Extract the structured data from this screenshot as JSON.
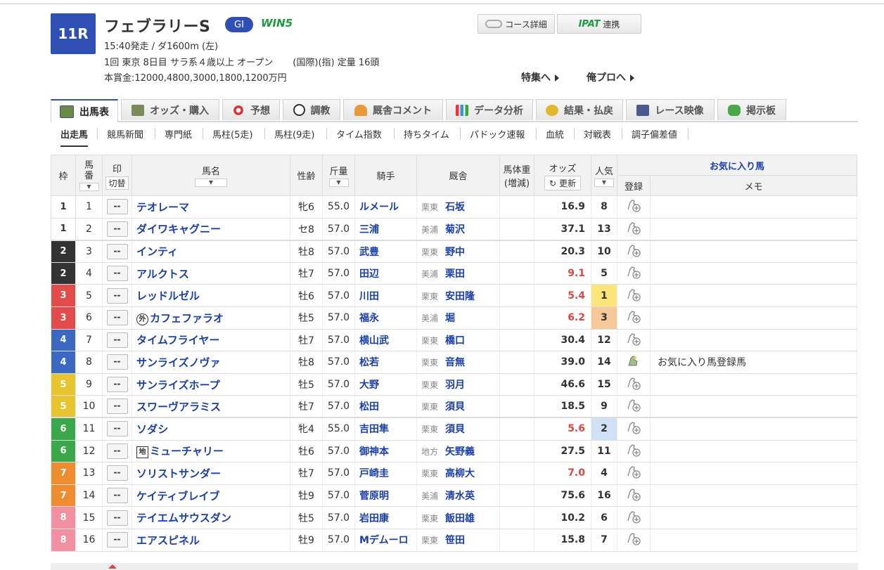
{
  "race": {
    "number": "11R",
    "name": "フェブラリーS",
    "grade": "GI",
    "win5": "WIN5",
    "start_info": "15:40発走 / ダ1600m (左)",
    "meeting_info": "1回 東京 8日目 サラ系４歳以上 オープン",
    "conditions": "(国際)(指) 定量 16頭",
    "prize": "本賞金:12000,4800,3000,1800,1200万円"
  },
  "top_buttons": {
    "course": "コース詳細",
    "ipat_logo": "IPAT",
    "ipat": "連携"
  },
  "links": {
    "feature": "特集へ",
    "orepro": "俺プロへ"
  },
  "tabs": [
    {
      "label": "出馬表",
      "icon": "table-icon"
    },
    {
      "label": "オッズ・購入",
      "icon": "odds-icon"
    },
    {
      "label": "予想",
      "icon": "target-icon"
    },
    {
      "label": "調教",
      "icon": "stopwatch-icon"
    },
    {
      "label": "厩舎コメント",
      "icon": "stable-icon"
    },
    {
      "label": "データ分析",
      "icon": "bar-chart-icon"
    },
    {
      "label": "結果・払戻",
      "icon": "coins-icon"
    },
    {
      "label": "レース映像",
      "icon": "video-icon"
    },
    {
      "label": "掲示板",
      "icon": "chat-icon"
    }
  ],
  "subnav": [
    "出走馬",
    "競馬新聞",
    "専門紙",
    "馬柱(5走)",
    "馬柱(9走)",
    "タイム指数",
    "持ちタイム",
    "パドック速報",
    "血統",
    "対戦表",
    "調子偏差値"
  ],
  "table_headers": {
    "waku": "枠",
    "umaban": "馬番",
    "mark": "印",
    "mark_switch": "切替",
    "horse": "馬名",
    "sex_age": "性齢",
    "weight_carried": "斤量",
    "jockey": "騎手",
    "trainer": "厩舎",
    "body_weight": "馬体重",
    "body_weight_sub": "(増減)",
    "odds": "オッズ",
    "update": "更新",
    "popularity": "人気",
    "favorites": "お気に入り馬",
    "register": "登録",
    "memo": "メモ"
  },
  "colors": {
    "waku": {
      "1": "#ffffff",
      "2": "#333333",
      "3": "#e34b4b",
      "4": "#3b69c2",
      "5": "#e8c52e",
      "6": "#3aa84a",
      "7": "#f08c30",
      "8": "#f090a0"
    },
    "accent": "#2f4fb5",
    "link": "#1a3fa8",
    "odds_hot": "#e04545"
  },
  "horses": [
    {
      "waku": "1",
      "umaban": "1",
      "mark": "--",
      "badge": "",
      "name": "テオレーマ",
      "sex_age": "牝6",
      "kin": "55.0",
      "jockey": "ルメール",
      "area": "栗東",
      "trainer": "石坂",
      "odds": "16.9",
      "hot": false,
      "pop": "8",
      "memo": "",
      "registered": false
    },
    {
      "waku": "1",
      "umaban": "2",
      "mark": "--",
      "badge": "",
      "name": "ダイワキャグニー",
      "sex_age": "セ8",
      "kin": "57.0",
      "jockey": "三浦",
      "area": "美浦",
      "trainer": "菊沢",
      "odds": "37.1",
      "hot": false,
      "pop": "13",
      "memo": "",
      "registered": false
    },
    {
      "waku": "2",
      "umaban": "3",
      "mark": "--",
      "badge": "",
      "name": "インティ",
      "sex_age": "牡8",
      "kin": "57.0",
      "jockey": "武豊",
      "area": "栗東",
      "trainer": "野中",
      "odds": "20.3",
      "hot": false,
      "pop": "10",
      "memo": "",
      "registered": false
    },
    {
      "waku": "2",
      "umaban": "4",
      "mark": "--",
      "badge": "",
      "name": "アルクトス",
      "sex_age": "牡7",
      "kin": "57.0",
      "jockey": "田辺",
      "area": "美浦",
      "trainer": "栗田",
      "odds": "9.1",
      "hot": true,
      "pop": "5",
      "memo": "",
      "registered": false
    },
    {
      "waku": "3",
      "umaban": "5",
      "mark": "--",
      "badge": "",
      "name": "レッドルゼル",
      "sex_age": "牡6",
      "kin": "57.0",
      "jockey": "川田",
      "area": "栗東",
      "trainer": "安田隆",
      "odds": "5.4",
      "hot": true,
      "pop": "1",
      "memo": "",
      "registered": false
    },
    {
      "waku": "3",
      "umaban": "6",
      "mark": "--",
      "badge": "外",
      "name": "カフェファラオ",
      "sex_age": "牡5",
      "kin": "57.0",
      "jockey": "福永",
      "area": "美浦",
      "trainer": "堀",
      "odds": "6.2",
      "hot": true,
      "pop": "3",
      "memo": "",
      "registered": false
    },
    {
      "waku": "4",
      "umaban": "7",
      "mark": "--",
      "badge": "",
      "name": "タイムフライヤー",
      "sex_age": "牡7",
      "kin": "57.0",
      "jockey": "横山武",
      "area": "栗東",
      "trainer": "橋口",
      "odds": "30.4",
      "hot": false,
      "pop": "12",
      "memo": "",
      "registered": false
    },
    {
      "waku": "4",
      "umaban": "8",
      "mark": "--",
      "badge": "",
      "name": "サンライズノヴァ",
      "sex_age": "牡8",
      "kin": "57.0",
      "jockey": "松若",
      "area": "栗東",
      "trainer": "音無",
      "odds": "39.0",
      "hot": false,
      "pop": "14",
      "memo": "お気に入り馬登録馬",
      "registered": true
    },
    {
      "waku": "5",
      "umaban": "9",
      "mark": "--",
      "badge": "",
      "name": "サンライズホープ",
      "sex_age": "牡5",
      "kin": "57.0",
      "jockey": "大野",
      "area": "栗東",
      "trainer": "羽月",
      "odds": "46.6",
      "hot": false,
      "pop": "15",
      "memo": "",
      "registered": false
    },
    {
      "waku": "5",
      "umaban": "10",
      "mark": "--",
      "badge": "",
      "name": "スワーヴアラミス",
      "sex_age": "牡7",
      "kin": "57.0",
      "jockey": "松田",
      "area": "栗東",
      "trainer": "須貝",
      "odds": "18.5",
      "hot": false,
      "pop": "9",
      "memo": "",
      "registered": false
    },
    {
      "waku": "6",
      "umaban": "11",
      "mark": "--",
      "badge": "",
      "name": "ソダシ",
      "sex_age": "牝4",
      "kin": "55.0",
      "jockey": "吉田隼",
      "area": "栗東",
      "trainer": "須貝",
      "odds": "5.6",
      "hot": true,
      "pop": "2",
      "memo": "",
      "registered": false
    },
    {
      "waku": "6",
      "umaban": "12",
      "mark": "--",
      "badge": "地",
      "name": "ミューチャリー",
      "sex_age": "牡6",
      "kin": "57.0",
      "jockey": "御神本",
      "area": "地方",
      "trainer": "矢野義",
      "odds": "27.5",
      "hot": false,
      "pop": "11",
      "memo": "",
      "registered": false
    },
    {
      "waku": "7",
      "umaban": "13",
      "mark": "--",
      "badge": "",
      "name": "ソリストサンダー",
      "sex_age": "牡7",
      "kin": "57.0",
      "jockey": "戸崎圭",
      "area": "栗東",
      "trainer": "高柳大",
      "odds": "7.0",
      "hot": true,
      "pop": "4",
      "memo": "",
      "registered": false
    },
    {
      "waku": "7",
      "umaban": "14",
      "mark": "--",
      "badge": "",
      "name": "ケイティブレイブ",
      "sex_age": "牡9",
      "kin": "57.0",
      "jockey": "菅原明",
      "area": "美浦",
      "trainer": "清水英",
      "odds": "75.6",
      "hot": false,
      "pop": "16",
      "memo": "",
      "registered": false
    },
    {
      "waku": "8",
      "umaban": "15",
      "mark": "--",
      "badge": "",
      "name": "テイエムサウスダン",
      "sex_age": "牡5",
      "kin": "57.0",
      "jockey": "岩田康",
      "area": "栗東",
      "trainer": "飯田雄",
      "odds": "10.2",
      "hot": false,
      "pop": "6",
      "memo": "",
      "registered": false
    },
    {
      "waku": "8",
      "umaban": "16",
      "mark": "--",
      "badge": "",
      "name": "エアスピネル",
      "sex_age": "牡9",
      "kin": "57.0",
      "jockey": "Mデムーロ",
      "area": "栗東",
      "trainer": "笹田",
      "odds": "15.8",
      "hot": false,
      "pop": "7",
      "memo": "",
      "registered": false
    }
  ]
}
